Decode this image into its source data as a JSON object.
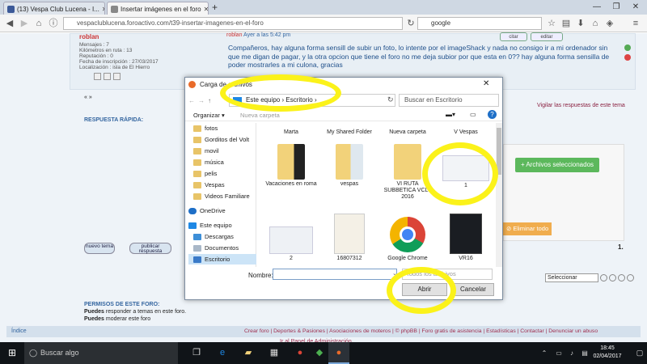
{
  "browser": {
    "tabs": [
      {
        "title": "(13) Vespa Club Lucena - I...",
        "favicon_color": "#3b5998"
      },
      {
        "title": "Insertar imágenes en el foro",
        "favicon_color": "#888888"
      }
    ],
    "url": "vespaclublucena.foroactivo.com/t39-insertar-imagenes-en-el-foro",
    "search": "google"
  },
  "post": {
    "author": "roblan",
    "header_user": "roblan",
    "header_date": "Ayer a las 5:42 pm",
    "mensajes": "Mensajes : 7",
    "kilometros": "Kilómetros en ruta : 13",
    "reputacion": "Reputación : 0",
    "fecha": "Fecha de inscripción : 27/03/2017",
    "localizacion": "Localización : isla de El Hierro",
    "citar": "citar",
    "editar": "editar",
    "message": "Compañeros, hay alguna forma sensill de subir un foto, lo intente por el imageShack y nada no consigo ir a mi ordenador sin que me digan de pagar, y la otra opcion que tiene el foro no me deja subior por que esta en 0?? hay alguna forma sensilla de poder mostrarles a mi culona, gracias"
  },
  "page": {
    "nav_arrows": "« »",
    "watch": "Vigilar las respuestas de este tema",
    "quick_reply": "RESPUESTA RÁPIDA:",
    "new_topic": "nuevo tema",
    "post_reply": "publicar respuesta",
    "page_num": "1.",
    "select": "Seleccionar",
    "perm_title": "PERMISOS DE ESTE FORO:",
    "perm1_bold": "Puedes",
    "perm1": "responder a temas en este foro.",
    "perm2_bold": "Puedes",
    "perm2": "moderar este foro",
    "footer_index": "Índice",
    "footer_links": "Crear foro | Deportes & Pasiones | Asociaciones de moteros | © phpBB | Foro gratis de asistencia | Estadísticas | Contactar | Denunciar un abuso",
    "admin_link": "Ir al Panel de Administración",
    "archivos_btn": "+ Archivos seleccionados",
    "eliminar_btn": "⊘ Eliminar todo"
  },
  "dialog": {
    "title": "Carga de archivos",
    "crumb1": "Este equipo",
    "crumb2": "Escritorio",
    "search_placeholder": "Buscar en Escritorio",
    "organizar": "Organizar ▾",
    "nueva_carpeta": "Nueva carpeta",
    "nav": [
      {
        "label": "fotos",
        "type": "folder"
      },
      {
        "label": "Gorditos del Volt",
        "type": "folder"
      },
      {
        "label": "movil",
        "type": "folder"
      },
      {
        "label": "música",
        "type": "folder"
      },
      {
        "label": "pelis",
        "type": "folder"
      },
      {
        "label": "Vespas",
        "type": "folder"
      },
      {
        "label": "Videos Familiare",
        "type": "folder"
      },
      {
        "label": "OneDrive",
        "type": "cloud"
      },
      {
        "label": "Este equipo",
        "type": "pc"
      },
      {
        "label": "Descargas",
        "type": "down"
      },
      {
        "label": "Documentos",
        "type": "doc"
      },
      {
        "label": "Escritorio",
        "type": "desk"
      }
    ],
    "files_top": [
      "Marta",
      "My Shared Folder",
      "Nueva carpeta",
      "V Vespas"
    ],
    "files_row1": [
      "Vacaciones en roma",
      "vespas",
      "VI RUTA SUBBETICA VCL - 2016",
      "1"
    ],
    "files_row2": [
      "2",
      "16807312",
      "Google Chrome",
      "VR16"
    ],
    "name_label": "Nombre:",
    "type_filter": "Todos los archivos",
    "open": "Abrir",
    "cancel": "Cancelar"
  },
  "taskbar": {
    "search": "Buscar algo",
    "time": "18:45",
    "date": "02/04/2017"
  },
  "colors": {
    "highlight": "#fbf21a",
    "accent_green": "#5cb85c",
    "accent_orange": "#f0ad4e"
  }
}
